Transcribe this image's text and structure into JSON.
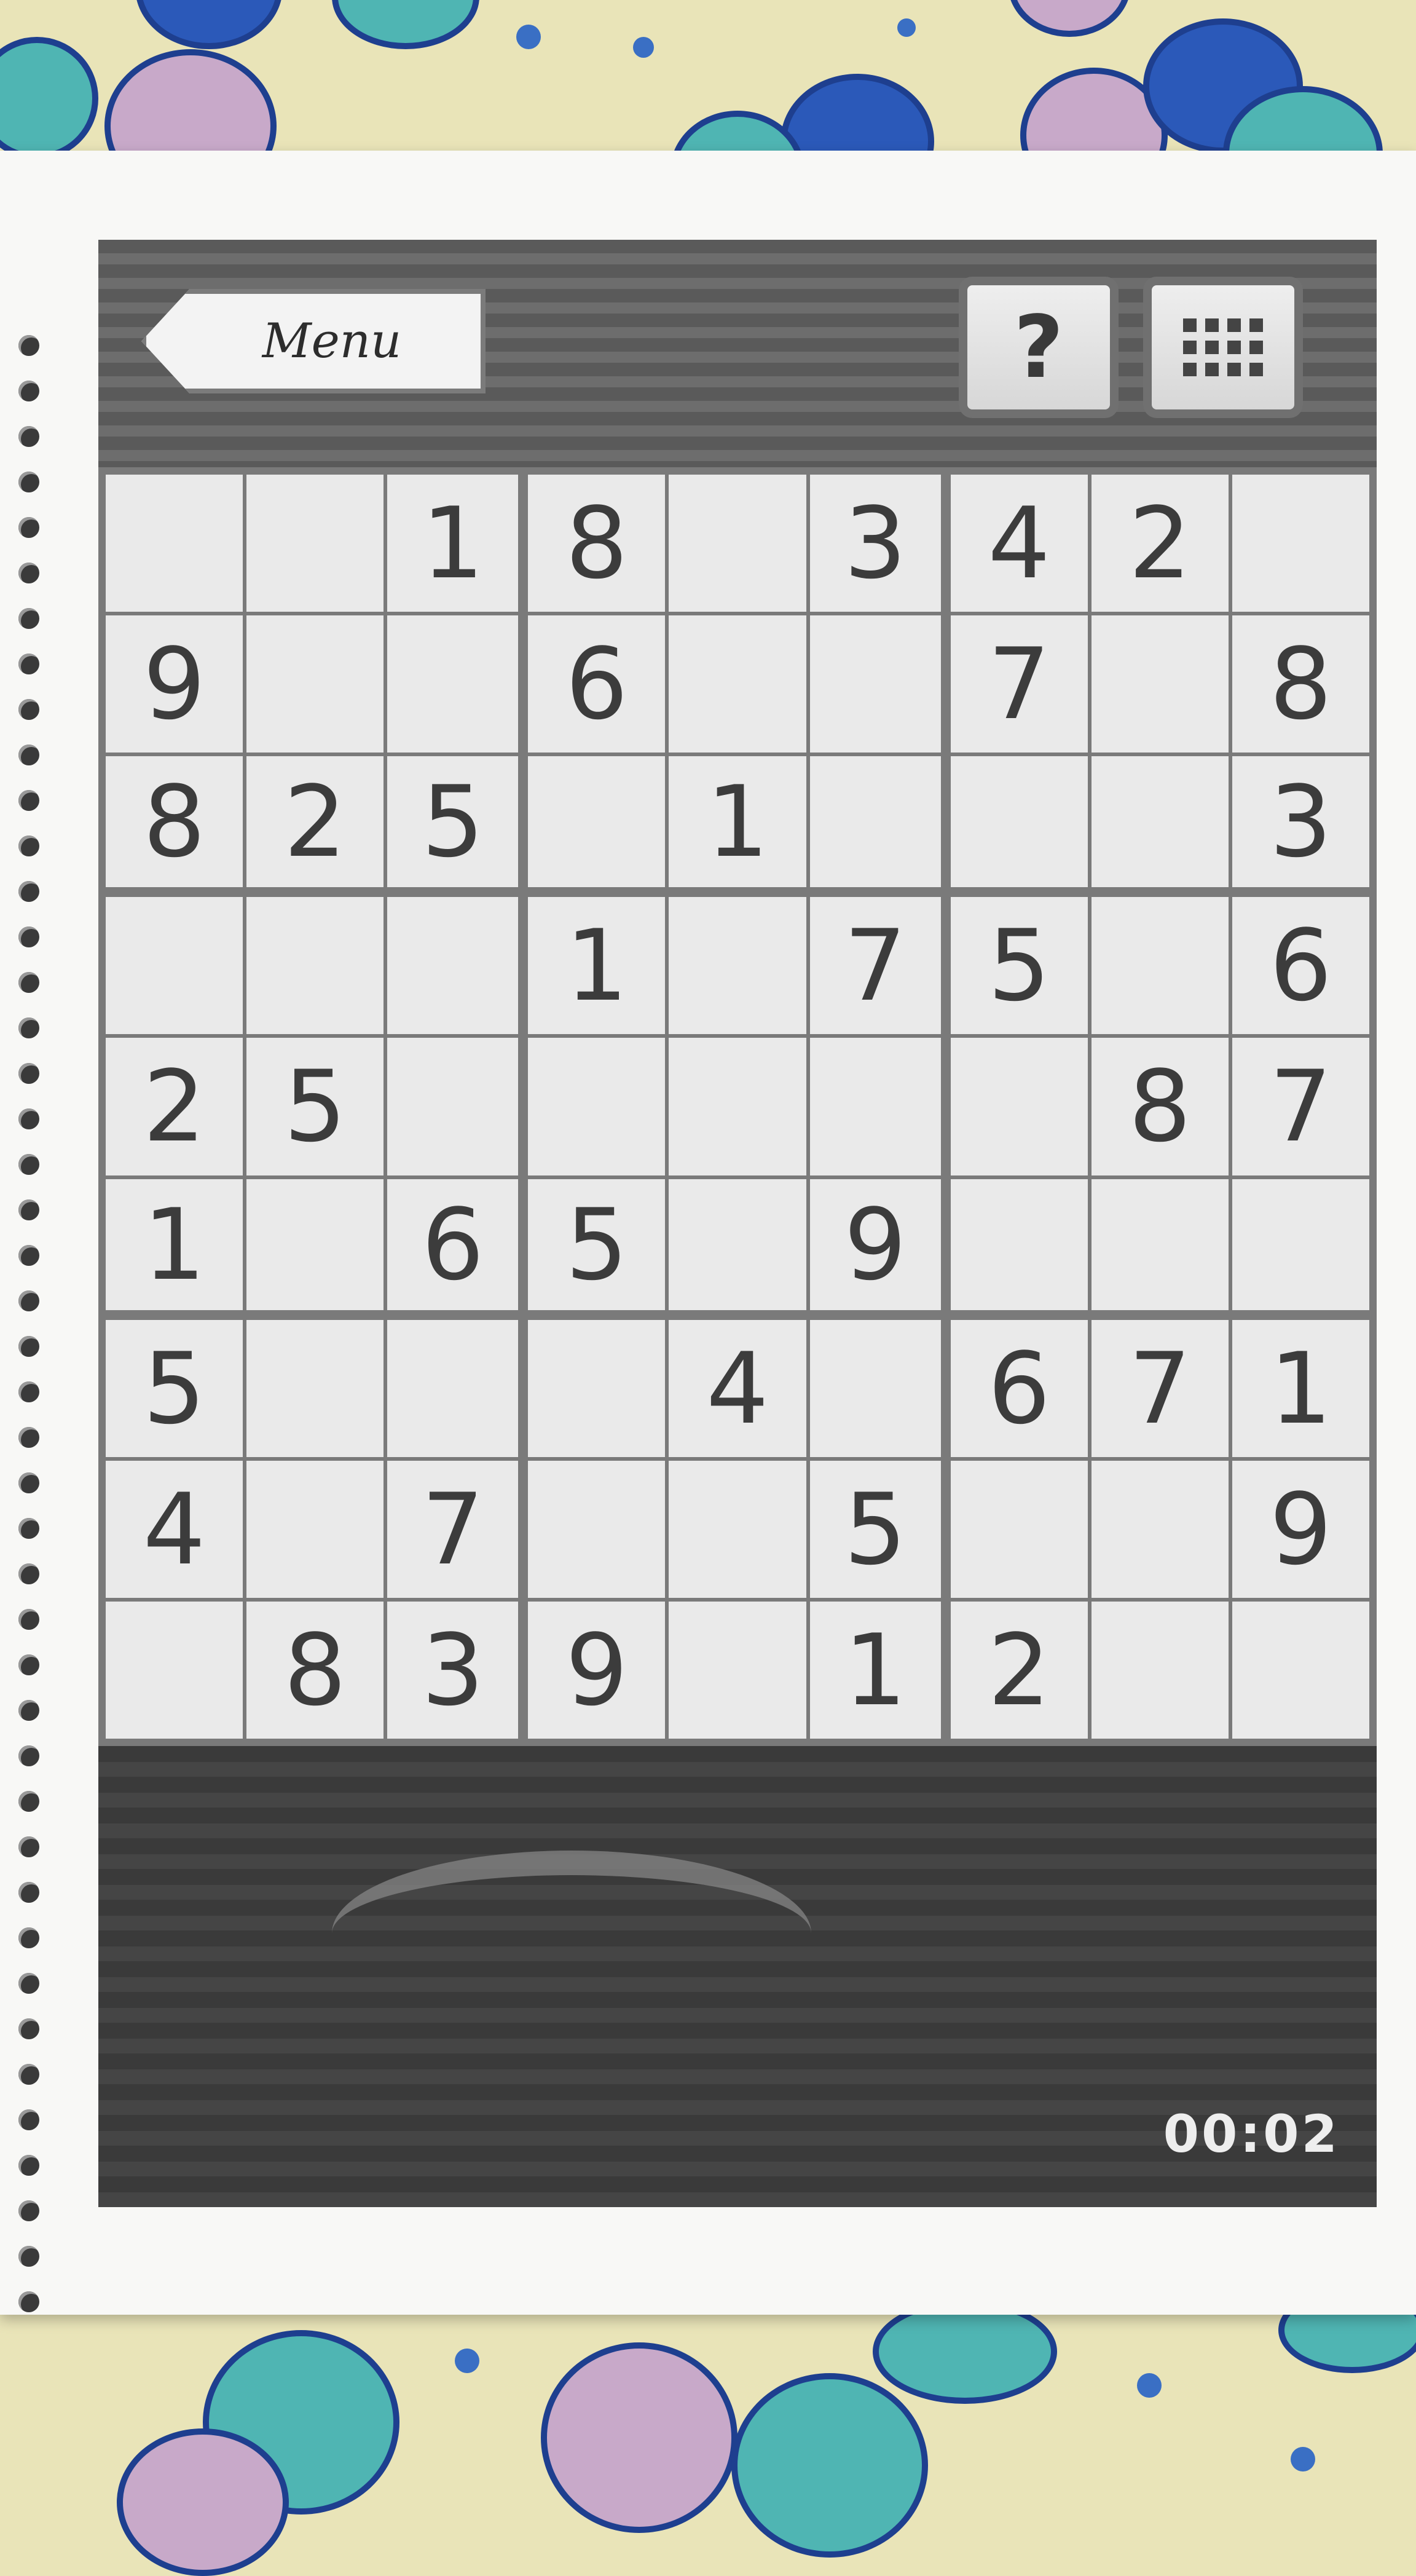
{
  "header": {
    "menu_label": "Menu",
    "help_label": "?",
    "grid_icon": "grid-icon"
  },
  "board": {
    "cells": [
      [
        "",
        "",
        "1",
        "8",
        "",
        "3",
        "4",
        "2",
        ""
      ],
      [
        "9",
        "",
        "",
        "6",
        "",
        "",
        "7",
        "",
        "8"
      ],
      [
        "8",
        "2",
        "5",
        "",
        "1",
        "",
        "",
        "",
        "3"
      ],
      [
        "",
        "",
        "",
        "1",
        "",
        "7",
        "5",
        "",
        "6"
      ],
      [
        "2",
        "5",
        "",
        "",
        "",
        "",
        "",
        "8",
        "7"
      ],
      [
        "1",
        "",
        "6",
        "5",
        "",
        "9",
        "",
        "",
        ""
      ],
      [
        "5",
        "",
        "",
        "",
        "4",
        "",
        "6",
        "7",
        "1"
      ],
      [
        "4",
        "",
        "7",
        "",
        "",
        "5",
        "",
        "",
        "9"
      ],
      [
        "",
        "8",
        "3",
        "9",
        "",
        "1",
        "2",
        "",
        ""
      ]
    ]
  },
  "status": {
    "timer": "00:02"
  }
}
